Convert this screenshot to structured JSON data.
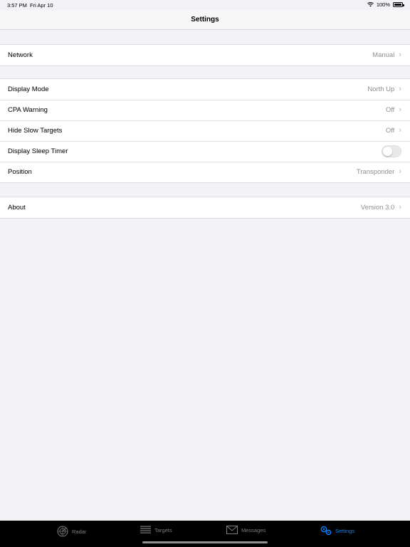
{
  "status_bar": {
    "time": "3:57 PM",
    "date": "Fri Apr 10",
    "battery": "100%"
  },
  "navbar": {
    "title": "Settings"
  },
  "groups": {
    "network": [
      {
        "label": "Network",
        "value": "Manual"
      }
    ],
    "display": [
      {
        "label": "Display Mode",
        "value": "North Up"
      },
      {
        "label": "CPA Warning",
        "value": "Off"
      },
      {
        "label": "Hide Slow Targets",
        "value": "Off"
      },
      {
        "label": "Display Sleep Timer",
        "toggle_on": false
      },
      {
        "label": "Position",
        "value": "Transponder"
      }
    ],
    "about": [
      {
        "label": "About",
        "value": "Version 3.0"
      }
    ]
  },
  "tabbar": {
    "tabs": [
      {
        "label": "Radar",
        "icon": "radar-icon",
        "active": false
      },
      {
        "label": "Targets",
        "icon": "list-icon",
        "active": false
      },
      {
        "label": "Messages",
        "icon": "envelope-icon",
        "active": false
      },
      {
        "label": "Settings",
        "icon": "gears-icon",
        "active": true
      }
    ]
  },
  "colors": {
    "accent": "#0a84ff",
    "background": "#f2f2f7",
    "secondary_text": "#8e8e93"
  }
}
